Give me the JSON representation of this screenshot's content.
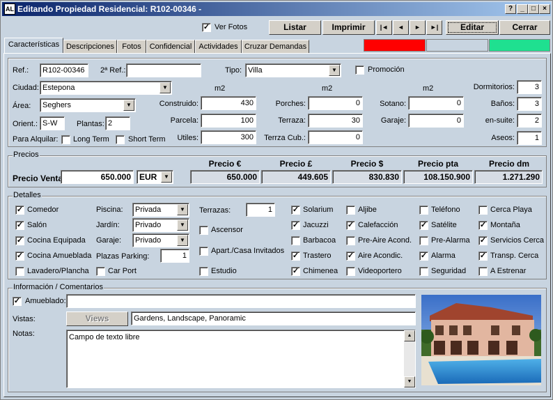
{
  "window": {
    "title": "Editando Propiedad Residencial: R102-00346 -",
    "icon_text": "AL"
  },
  "toolbar": {
    "ver_fotos": "Ver Fotos",
    "listar": "Listar",
    "imprimir": "Imprimir",
    "editar": "Editar",
    "cerrar": "Cerrar",
    "nav_first": "|◄",
    "nav_prev": "◄",
    "nav_next": "►",
    "nav_last": "►|"
  },
  "tabs": [
    "Características",
    "Descripciones",
    "Fotos",
    "Confidencial",
    "Actividades",
    "Cruzar Demandas"
  ],
  "status_colors": [
    "#ff0000",
    "#c8d4e0",
    "#1fe090"
  ],
  "general": {
    "ref_label": "Ref.:",
    "ref": "R102-00346",
    "ref2_label": "2ª Ref.:",
    "ref2": "",
    "tipo_label": "Tipo:",
    "tipo": "Villa",
    "promocion": "Promoción",
    "ciudad_label": "Ciudad:",
    "ciudad": "Estepona",
    "area_label": "Área:",
    "area": "Seghers",
    "orient_label": "Orient.:",
    "orient": "S-W",
    "plantas_label": "Plantas:",
    "plantas": "2",
    "alquilar_label": "Para Alquilar:",
    "long_term": "Long Term",
    "short_term": "Short Term",
    "m2": "m2",
    "construido_label": "Construido:",
    "construido": "430",
    "parcela_label": "Parcela:",
    "parcela": "100",
    "utiles_label": "Utiles:",
    "utiles": "300",
    "porches_label": "Porches:",
    "porches": "0",
    "terraza_label": "Terraza:",
    "terraza": "30",
    "terrza_cub_label": "Terrza Cub.:",
    "terrza_cub": "0",
    "sotano_label": "Sotano:",
    "sotano": "0",
    "garaje_label": "Garaje:",
    "garaje": "0",
    "dormitorios_label": "Dormitorios:",
    "dormitorios": "3",
    "banos_label": "Baños:",
    "banos": "3",
    "ensuite_label": "en-suite:",
    "ensuite": "2",
    "aseos_label": "Aseos:",
    "aseos": "1"
  },
  "precios": {
    "label": "Precios",
    "venta_label": "Precio Venta",
    "venta": "650.000",
    "currency": "EUR",
    "headers": [
      "Precio €",
      "Precio £",
      "Precio $",
      "Precio pta",
      "Precio dm"
    ],
    "values": [
      "650.000",
      "449.605",
      "830.830",
      "108.150.900",
      "1.271.290"
    ]
  },
  "detalles": {
    "label": "Detalles",
    "piscina_label": "Piscina:",
    "piscina": "Privada",
    "jardin_label": "Jardín:",
    "jardin": "Privado",
    "garaje_label": "Garaje:",
    "garaje": "Privado",
    "plazas_label": "Plazas Parking:",
    "plazas": "1",
    "terrazas_label": "Terrazas:",
    "terrazas": "1",
    "checks": [
      {
        "label": "Comedor",
        "checked": true
      },
      {
        "label": "Salón",
        "checked": true
      },
      {
        "label": "Cocina Equipada",
        "checked": true
      },
      {
        "label": "Cocina Amueblada",
        "checked": true
      },
      {
        "label": "Lavadero/Plancha",
        "checked": false
      },
      {
        "label": "Car Port",
        "checked": false
      },
      {
        "label": "Ascensor",
        "checked": false
      },
      {
        "label": "Apart./Casa Invitados",
        "checked": false
      },
      {
        "label": "Estudio",
        "checked": false
      },
      {
        "label": "Solarium",
        "checked": true
      },
      {
        "label": "Jacuzzi",
        "checked": true
      },
      {
        "label": "Barbacoa",
        "checked": false
      },
      {
        "label": "Trastero",
        "checked": true
      },
      {
        "label": "Chimenea",
        "checked": true
      },
      {
        "label": "Aljibe",
        "checked": false
      },
      {
        "label": "Calefacción",
        "checked": true
      },
      {
        "label": "Pre-Aire Acond.",
        "checked": false
      },
      {
        "label": "Aire Acondic.",
        "checked": true
      },
      {
        "label": "Videoportero",
        "checked": false
      },
      {
        "label": "Teléfono",
        "checked": false
      },
      {
        "label": "Satélite",
        "checked": true
      },
      {
        "label": "Pre-Alarma",
        "checked": false
      },
      {
        "label": "Alarma",
        "checked": true
      },
      {
        "label": "Seguridad",
        "checked": false
      },
      {
        "label": "Cerca Playa",
        "checked": false
      },
      {
        "label": "Montaña",
        "checked": true
      },
      {
        "label": "Servicios Cerca",
        "checked": true
      },
      {
        "label": "Transp. Cerca",
        "checked": true
      },
      {
        "label": "A Estrenar",
        "checked": false
      }
    ]
  },
  "info": {
    "label": "Información / Comentarios",
    "amueblado_label": "Amueblado:",
    "amueblado": "",
    "vistas_label": "Vistas:",
    "views_button": "Views",
    "vistas": "Gardens, Landscape, Panoramic",
    "notas_label": "Notas:",
    "notas": "Campo de texto libre"
  },
  "icons": {
    "check": "✓",
    "dropdown": "▼"
  }
}
